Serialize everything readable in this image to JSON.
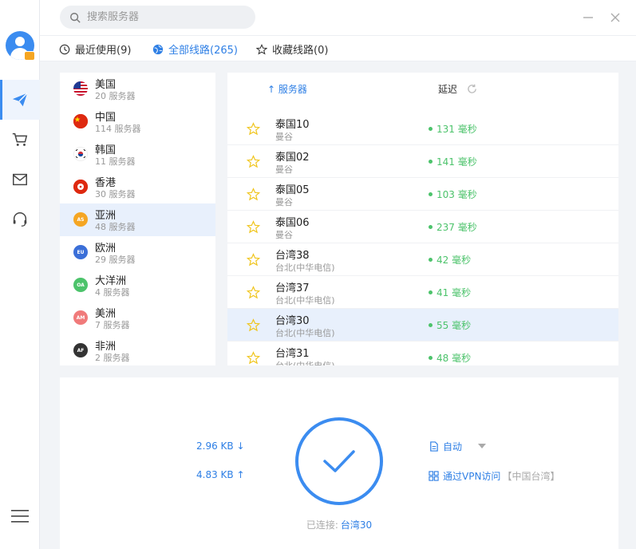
{
  "search": {
    "placeholder": "搜索服务器"
  },
  "tabs": [
    {
      "label": "最近使用(9)",
      "icon": "clock-icon"
    },
    {
      "label": "全部线路(265)",
      "icon": "globe-icon"
    },
    {
      "label": "收藏线路(0)",
      "icon": "star-icon"
    }
  ],
  "rail": [
    "send-icon",
    "cart-icon",
    "mail-icon",
    "headset-icon",
    "menu-icon"
  ],
  "regions": [
    {
      "name": "美国",
      "count": "20 服务器",
      "flag": "us",
      "badge": ""
    },
    {
      "name": "中国",
      "count": "114 服务器",
      "flag": "cn",
      "badge": ""
    },
    {
      "name": "韩国",
      "count": "11 服务器",
      "flag": "kr",
      "badge": ""
    },
    {
      "name": "香港",
      "count": "30 服务器",
      "flag": "hk",
      "badge": ""
    },
    {
      "name": "亚洲",
      "count": "48 服务器",
      "flag": "as",
      "badge": "AS",
      "color": "#f5a623"
    },
    {
      "name": "欧洲",
      "count": "29 服务器",
      "flag": "eu",
      "badge": "EU",
      "color": "#3b6fd8"
    },
    {
      "name": "大洋洲",
      "count": "4 服务器",
      "flag": "oa",
      "badge": "OA",
      "color": "#4cc36b"
    },
    {
      "name": "美洲",
      "count": "7 服务器",
      "flag": "am",
      "badge": "AM",
      "color": "#f07a7a"
    },
    {
      "name": "非洲",
      "count": "2 服务器",
      "flag": "af",
      "badge": "AF",
      "color": "#333333"
    }
  ],
  "server_header": {
    "server": "↑ 服务器",
    "delay": "延迟"
  },
  "servers": [
    {
      "name": "泰国10",
      "loc": "曼谷",
      "delay": "131 毫秒"
    },
    {
      "name": "泰国02",
      "loc": "曼谷",
      "delay": "141 毫秒"
    },
    {
      "name": "泰国05",
      "loc": "曼谷",
      "delay": "103 毫秒"
    },
    {
      "name": "泰国06",
      "loc": "曼谷",
      "delay": "237 毫秒"
    },
    {
      "name": "台湾38",
      "loc": "台北(中华电信)",
      "delay": "42 毫秒"
    },
    {
      "name": "台湾37",
      "loc": "台北(中华电信)",
      "delay": "41 毫秒"
    },
    {
      "name": "台湾30",
      "loc": "台北(中华电信)",
      "delay": "55 毫秒"
    },
    {
      "name": "台湾31",
      "loc": "台北(中华电信)",
      "delay": "48 毫秒"
    }
  ],
  "traffic": {
    "down": "2.96 KB ↓",
    "up": "4.83 KB ↑"
  },
  "mode": {
    "label": "自动"
  },
  "vpn_access": {
    "label": "通过VPN访问",
    "note": "【中国台湾】"
  },
  "status": {
    "label": "已连接:",
    "server": "台湾30"
  },
  "colors": {
    "accent": "#2e7fe5",
    "latency": "#4cc36b"
  }
}
